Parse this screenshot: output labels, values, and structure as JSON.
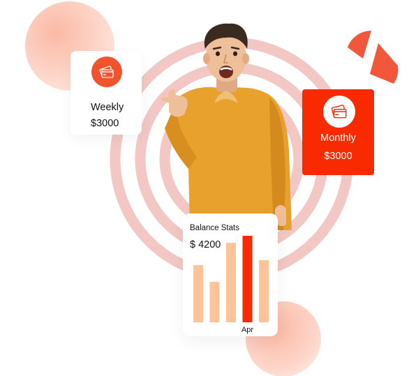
{
  "weekly_card": {
    "label": "Weekly",
    "amount": "$3000",
    "icon": "credit-card-icon"
  },
  "monthly_card": {
    "label": "Monthly",
    "amount": "$3000",
    "icon": "credit-card-icon"
  },
  "balance_card": {
    "title": "Balance Stats",
    "amount": "$ 4200"
  },
  "chart_data": {
    "type": "bar",
    "title": "Balance Stats",
    "categories": [
      "",
      "",
      "",
      "Apr",
      ""
    ],
    "values": [
      82,
      58,
      114,
      124,
      89
    ],
    "highlight_index": 3,
    "colors": {
      "bar": "#ffc39a",
      "highlight": "#fa2a00"
    }
  },
  "colors": {
    "accent": "#fa2a00",
    "accent_soft": "#f1542c",
    "ring": "#f2c7c4",
    "pie": "#f1583b",
    "blob": "#fdd5c8"
  }
}
